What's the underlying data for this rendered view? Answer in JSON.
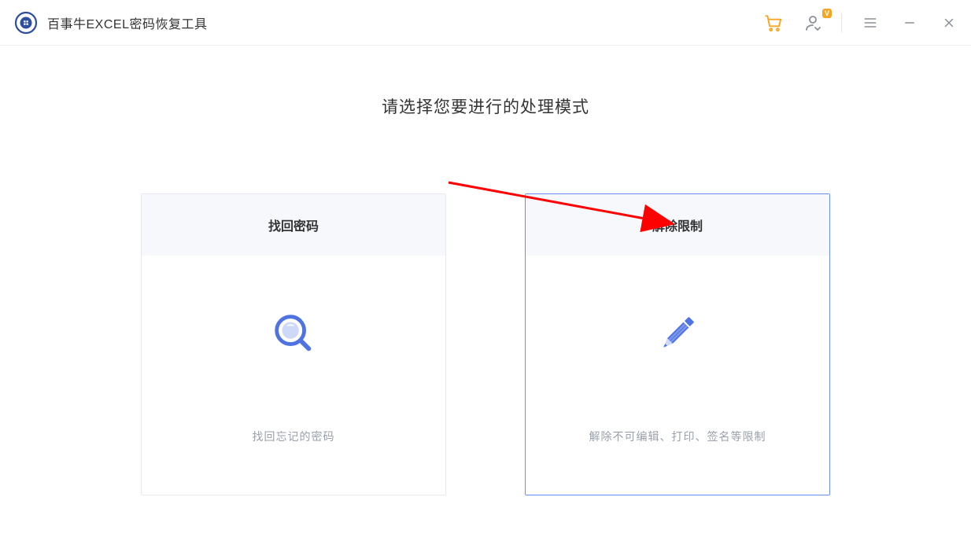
{
  "header": {
    "app_title": "百事牛EXCEL密码恢复工具",
    "user_badge": "V",
    "icons": {
      "cart": "cart-icon",
      "user": "user-icon",
      "menu": "menu-icon",
      "minimize": "minimize-icon",
      "close": "close-icon"
    }
  },
  "main": {
    "heading": "请选择您要进行的处理模式",
    "cards": [
      {
        "title": "找回密码",
        "description": "找回忘记的密码",
        "icon": "search-icon",
        "selected": false
      },
      {
        "title": "解除限制",
        "description": "解除不可编辑、打印、签名等限制",
        "icon": "pencil-icon",
        "selected": true
      }
    ]
  },
  "colors": {
    "accent": "#4f73e3",
    "brand_orange": "#f5a623",
    "text_muted": "#9aa0ab",
    "border_selected": "#6b8cf5",
    "arrow": "#ff0000"
  }
}
